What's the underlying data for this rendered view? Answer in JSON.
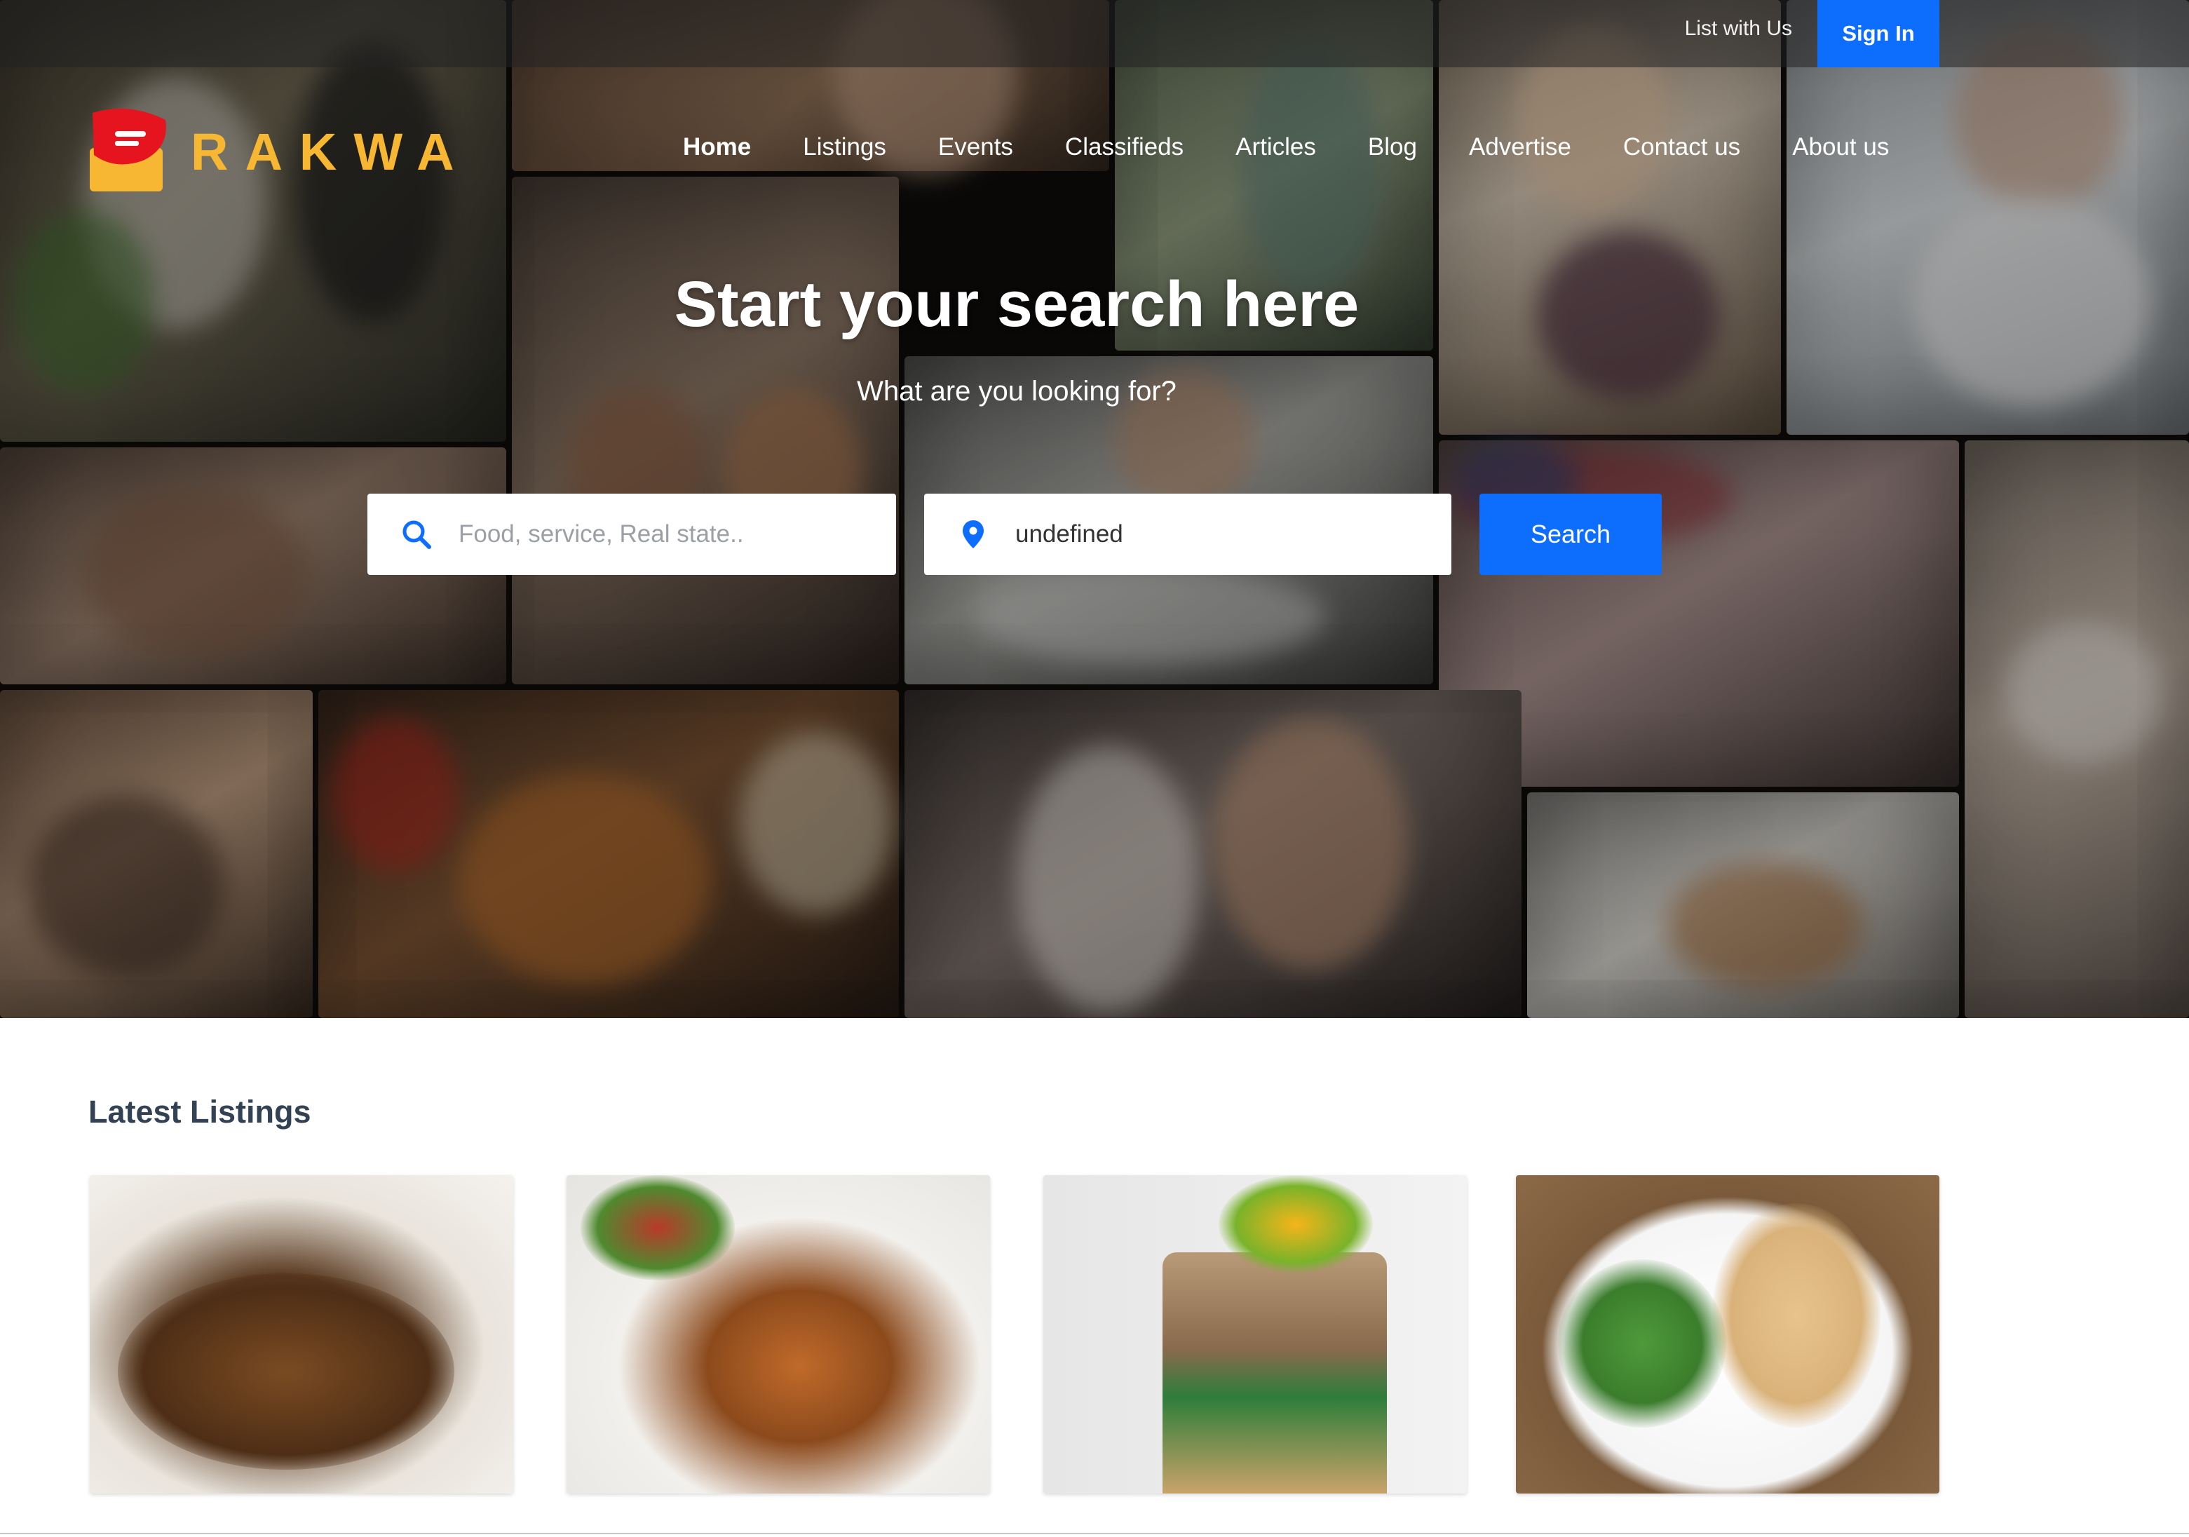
{
  "header": {
    "list_with_us": "List with Us",
    "sign_in": "Sign In"
  },
  "logo": {
    "text": "RAKWA"
  },
  "nav": {
    "items": [
      "Home",
      "Listings",
      "Events",
      "Classifieds",
      "Articles",
      "Blog",
      "Advertise",
      "Contact us",
      "About us"
    ],
    "active": "Home"
  },
  "hero": {
    "title": "Start your search here",
    "subtitle": "What are you looking for?"
  },
  "search": {
    "what_placeholder": "Food, service, Real state..",
    "what_value": "",
    "where_value": "undefined",
    "button": "Search",
    "icons": [
      "search-icon",
      "location-pin-icon"
    ]
  },
  "latest": {
    "title": "Latest Listings"
  },
  "colors": {
    "accent": "#0d6efd",
    "logo_red": "#e5141f",
    "logo_yellow": "#f7b733",
    "heading": "#334155"
  }
}
